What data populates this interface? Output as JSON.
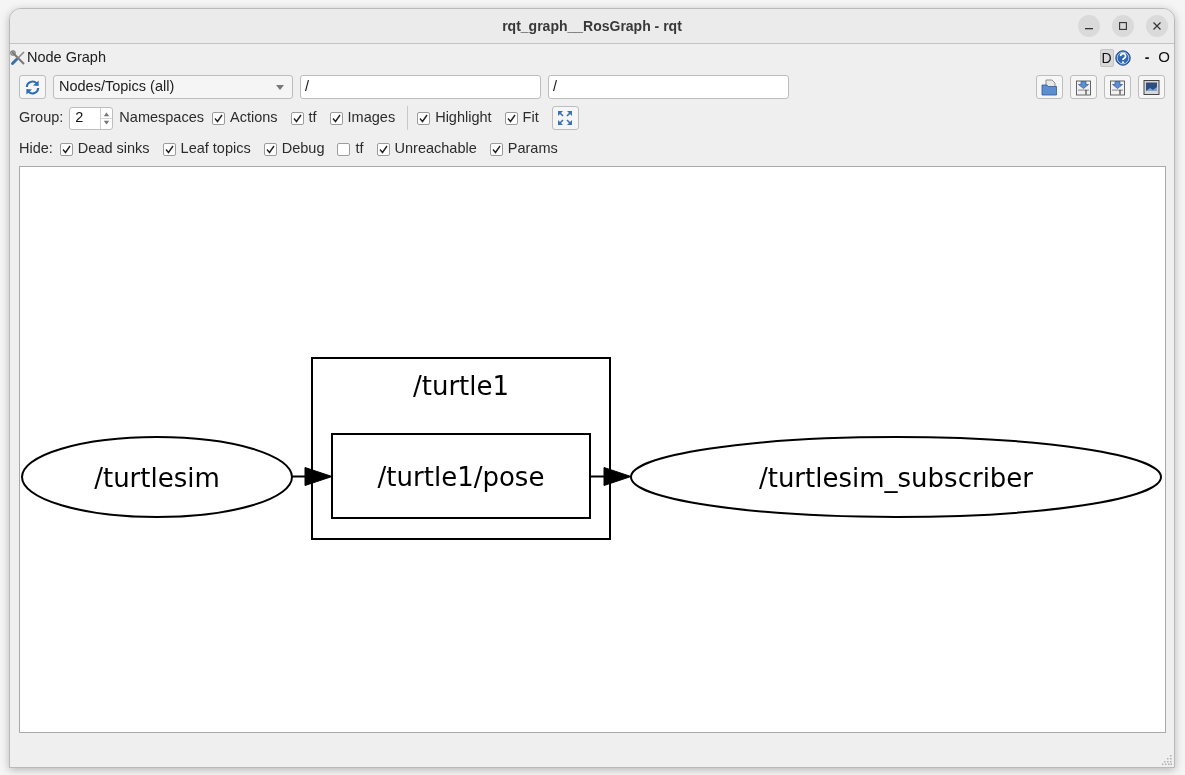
{
  "window": {
    "title": "rqt_graph__RosGraph - rqt"
  },
  "plugin": {
    "title": "Node Graph",
    "dock_label": "D",
    "minimize_label": "-",
    "close_label": "O"
  },
  "toolbar": {
    "graph_type": "Nodes/Topics (all)",
    "node_filter": "/",
    "topic_filter": "/"
  },
  "group_row": {
    "label": "Group:",
    "value": "2",
    "unit": "Namespaces",
    "checkboxes": [
      {
        "label": "Actions",
        "checked": true
      },
      {
        "label": "tf",
        "checked": true
      },
      {
        "label": "Images",
        "checked": true
      }
    ],
    "view_checkboxes": [
      {
        "label": "Highlight",
        "checked": true
      },
      {
        "label": "Fit",
        "checked": true
      }
    ]
  },
  "hide_row": {
    "label": "Hide:",
    "checkboxes": [
      {
        "label": "Dead sinks",
        "checked": true
      },
      {
        "label": "Leaf topics",
        "checked": true
      },
      {
        "label": "Debug",
        "checked": true
      },
      {
        "label": "tf",
        "checked": false
      },
      {
        "label": "Unreachable",
        "checked": true
      },
      {
        "label": "Params",
        "checked": true
      }
    ]
  },
  "graph": {
    "clusters": [
      {
        "label": "/turtle1"
      }
    ],
    "nodes": [
      {
        "kind": "node",
        "label": "/turtlesim"
      },
      {
        "kind": "topic",
        "label": "/turtle1/pose"
      },
      {
        "kind": "node",
        "label": "/turtlesim_subscriber"
      }
    ]
  }
}
